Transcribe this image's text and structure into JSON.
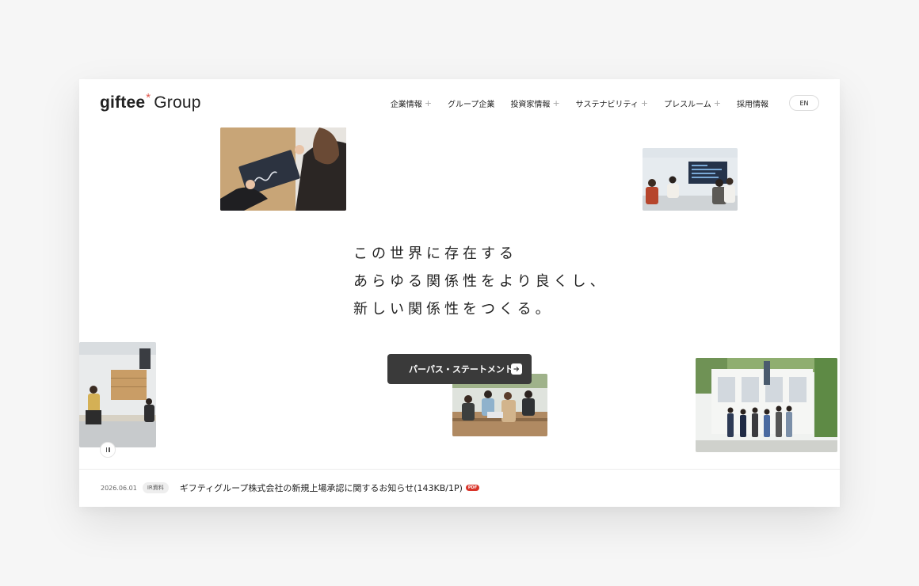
{
  "brand": {
    "name_bold": "giftee",
    "asterisk": "*",
    "name_light": "Group",
    "accent_color": "#e0574c"
  },
  "nav": {
    "items": [
      {
        "label": "企業情報",
        "has_submenu": true
      },
      {
        "label": "グループ企業",
        "has_submenu": false
      },
      {
        "label": "投資家情報",
        "has_submenu": true
      },
      {
        "label": "サステナビリティ",
        "has_submenu": true
      },
      {
        "label": "プレスルーム",
        "has_submenu": true
      },
      {
        "label": "採用情報",
        "has_submenu": false
      }
    ],
    "plus_symbol": "+",
    "lang_button": "EN"
  },
  "hero": {
    "lines": [
      "この世界に存在する",
      "あらゆる関係性をより良くし、",
      "新しい関係性をつくる。"
    ],
    "cta_label": "パーパス・ステートメント",
    "cta_icon": "arrow-right-icon",
    "cta_color": "#3a3a3a",
    "pause_icon": "pause-icon"
  },
  "news": {
    "date": "2026.06.01",
    "category": "IR資料",
    "title": "ギフティグループ株式会社の新規上場承認に関するお知らせ(143KB/1P)",
    "file_badge": "PDF",
    "badge_color": "#d9352b"
  }
}
